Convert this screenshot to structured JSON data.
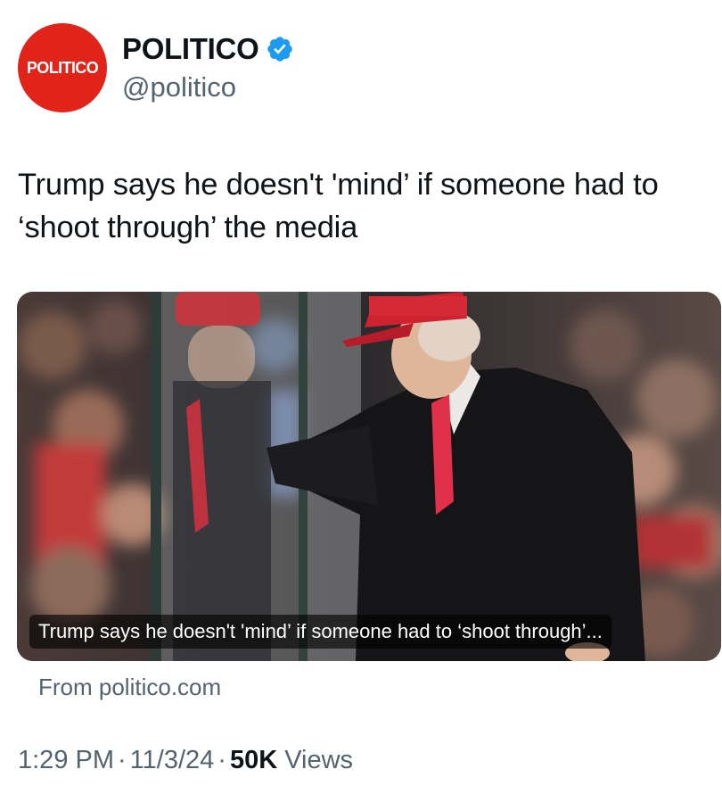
{
  "account": {
    "avatar_text": "POLITICO",
    "display_name": "POLITICO",
    "handle": "@politico",
    "verified_icon": "verified-badge-icon"
  },
  "tweet": {
    "text": "Trump says he doesn't 'mind’ if someone had to ‘shoot through’ the media"
  },
  "card": {
    "image_icon": "article-photo",
    "caption": "Trump says he doesn't 'mind’ if someone had to ‘shoot through’...",
    "source": "From politico.com"
  },
  "meta": {
    "time": "1:29 PM",
    "date": "11/3/24",
    "views_count": "50K",
    "views_label": "Views"
  },
  "colors": {
    "brand_red": "#e2231a",
    "verified_blue": "#1d9bf0",
    "secondary_text": "#536471"
  }
}
